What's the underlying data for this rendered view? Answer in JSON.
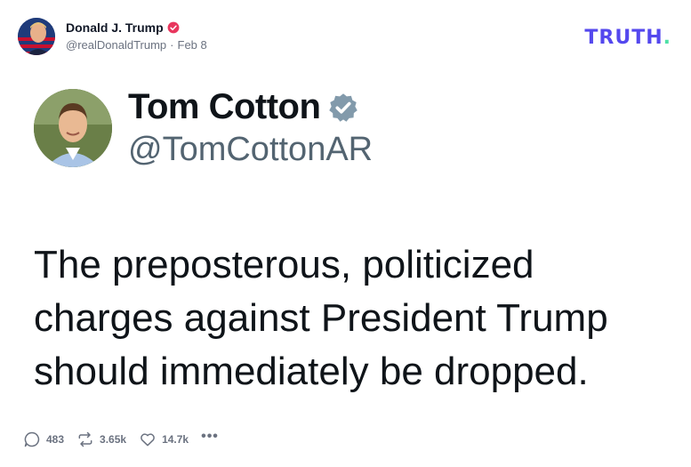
{
  "post": {
    "author_name": "Donald J. Trump",
    "handle": "@realDonaldTrump",
    "separator": "·",
    "date": "Feb 8"
  },
  "brand": {
    "text": "TRUTH",
    "dot": "."
  },
  "quote": {
    "name": "Tom Cotton",
    "handle": "@TomCottonAR",
    "text": "The preposterous, politicized charges against President Trump should immediately be dropped."
  },
  "actions": {
    "replies": "483",
    "reposts": "3.65k",
    "likes": "14.7k",
    "more": "•••"
  },
  "colors": {
    "brand": "#5448ee",
    "brand_dot": "#4ee0a6",
    "truth_verified": "#e8365d",
    "x_verified": "#829aab"
  }
}
